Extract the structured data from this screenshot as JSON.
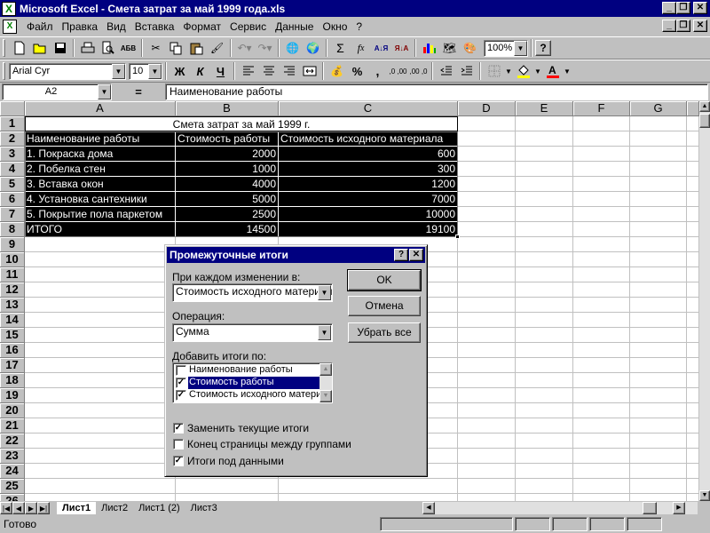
{
  "window": {
    "title": "Microsoft Excel - Смета затрат за май 1999 года.xls",
    "controls": {
      "minimize": "_",
      "restore": "❐",
      "close": "✕"
    }
  },
  "menu": {
    "items": [
      "Файл",
      "Правка",
      "Вид",
      "Вставка",
      "Формат",
      "Сервис",
      "Данные",
      "Окно",
      "?"
    ]
  },
  "standard_toolbar": {
    "icons": [
      "new-icon",
      "open-icon",
      "save-icon",
      "print-icon",
      "print-preview-icon",
      "spelling-icon",
      "cut-icon",
      "copy-icon",
      "paste-icon",
      "format-painter-icon",
      "undo-icon",
      "redo-icon",
      "hyperlink-icon",
      "web-toolbar-icon",
      "autosum-icon",
      "function-icon",
      "sort-ascending-icon",
      "sort-descending-icon",
      "chart-wizard-icon",
      "map-icon",
      "drawing-icon",
      "help-icon"
    ],
    "zoom": "100%"
  },
  "formatting_toolbar": {
    "font": "Arial Cyr",
    "size": "10",
    "bold": "Ж",
    "italic": "К",
    "underline": "Ч",
    "percent": "%",
    "comma": ",",
    "inc_decimal": ",0 ,00",
    "dec_decimal": ",00 ,0",
    "fill_color": "#ffff00",
    "font_color": "#ff0000"
  },
  "formula_bar": {
    "name_box": "A2",
    "equals": "=",
    "content": "Наименование работы"
  },
  "grid": {
    "columns": [
      "A",
      "B",
      "C",
      "D",
      "E",
      "F",
      "G"
    ],
    "rows": [
      "1",
      "2",
      "3",
      "4",
      "5",
      "6",
      "7",
      "8",
      "9",
      "10",
      "11",
      "12",
      "13",
      "14",
      "15",
      "16",
      "17",
      "18",
      "19",
      "20",
      "21",
      "22",
      "23",
      "24",
      "25",
      "26"
    ],
    "title": "Смета затрат за май 1999 г.",
    "header": [
      "Наименование работы",
      "Стоимость работы",
      "Стоимость исходного материала"
    ],
    "data": [
      [
        "1. Покраска дома",
        "2000",
        "600"
      ],
      [
        "2. Побелка стен",
        "1000",
        "300"
      ],
      [
        "3. Вставка окон",
        "4000",
        "1200"
      ],
      [
        "4. Установка сантехники",
        "5000",
        "7000"
      ],
      [
        "5. Покрытие пола паркетом",
        "2500",
        "10000"
      ],
      [
        "ИТОГО",
        "14500",
        "19100"
      ]
    ],
    "selection_color": "#000000"
  },
  "sheet_tabs": [
    "Лист1",
    "Лист2",
    "Лист1 (2)",
    "Лист3"
  ],
  "status": "Готово",
  "dialog": {
    "title": "Промежуточные итоги",
    "help_button": "?",
    "close_button": "✕",
    "at_each_change_label": "При каждом изменении в:",
    "at_each_change_value": "Стоимость исходного материала",
    "function_label": "Операция:",
    "function_value": "Сумма",
    "add_subtotal_label": "Добавить итоги по:",
    "subtotal_list": [
      {
        "label": "Наименование работы",
        "checked": false,
        "selected": false
      },
      {
        "label": "Стоимость работы",
        "checked": true,
        "selected": true
      },
      {
        "label": "Стоимость исходного материала",
        "checked": true,
        "selected": false
      }
    ],
    "options": [
      {
        "label": "Заменить текущие итоги",
        "checked": true
      },
      {
        "label": "Конец страницы между группами",
        "checked": false
      },
      {
        "label": "Итоги под данными",
        "checked": true
      }
    ],
    "ok": "OK",
    "cancel": "Отмена",
    "remove_all": "Убрать все"
  }
}
